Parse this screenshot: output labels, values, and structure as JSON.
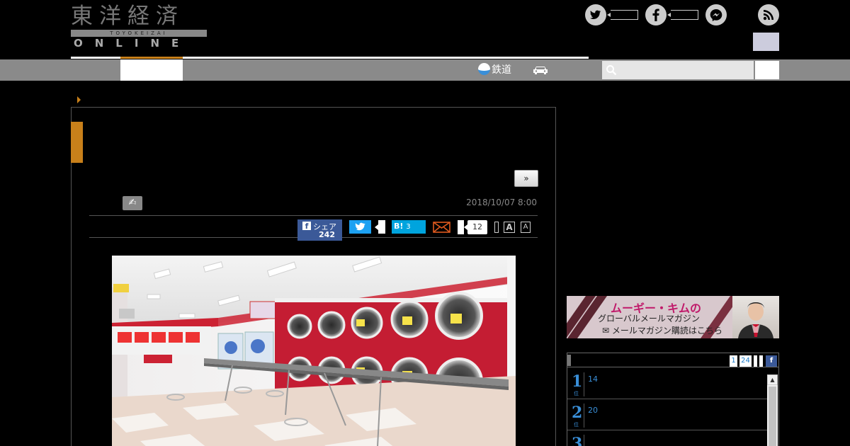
{
  "header": {
    "logo_kanji": "東洋経済",
    "logo_sub": "TOYOKEIZAI",
    "logo_online": "ONLINE"
  },
  "nav": {
    "railway_label": "鉄道",
    "search_placeholder": ""
  },
  "article": {
    "next_label": "»",
    "date": "2018/10/07 8:00",
    "share": {
      "facebook_label": "シェア",
      "facebook_count": "242",
      "hatena_label": "B!",
      "hatena_count": "3",
      "line_count": "12",
      "font_large": "A",
      "font_small": "A"
    },
    "photo_alt": "Interior of a coin laundromat with rows of red dryers"
  },
  "sidebar": {
    "banner": {
      "line1": "ムーギー・キムの",
      "line2": "グローバルメールマガジン",
      "line3": "✉ メールマガジン購読はこちら"
    },
    "ranking": {
      "tabs": [
        "1",
        "24"
      ],
      "items": [
        {
          "rank": "1",
          "suffix": "位",
          "count": "14"
        },
        {
          "rank": "2",
          "suffix": "位",
          "count": "20"
        },
        {
          "rank": "3",
          "suffix": "位",
          "count": ""
        }
      ]
    }
  },
  "colors": {
    "accent_orange": "#c8801a",
    "nav_gray": "#8a8a8a",
    "facebook": "#3b5998",
    "twitter": "#1da1f2",
    "hatena": "#00a4de",
    "rank_blue": "#3a8fd8"
  },
  "icons": [
    "twitter-icon",
    "facebook-icon",
    "messenger-icon",
    "rss-icon",
    "search-icon",
    "car-icon",
    "mail-icon",
    "author-icon"
  ]
}
